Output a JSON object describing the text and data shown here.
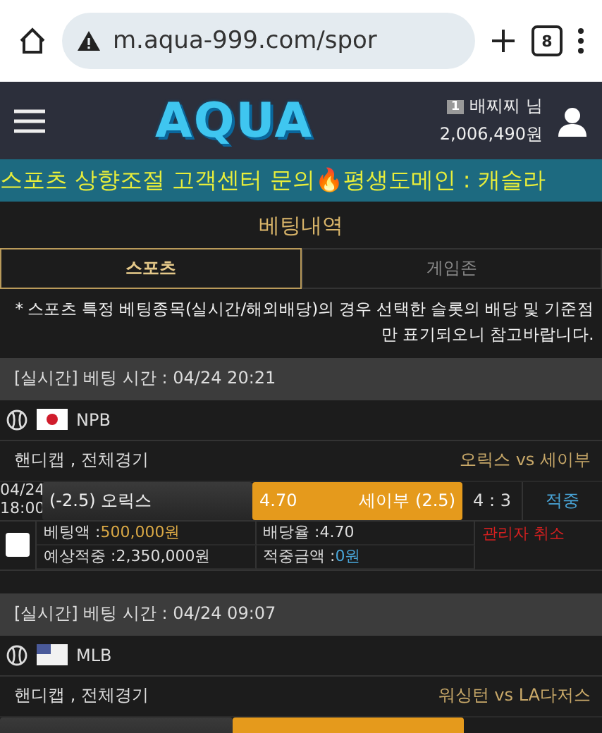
{
  "browser": {
    "url": "m.aqua-999.com/spor",
    "tab_count": "8"
  },
  "header": {
    "logo": "AQUA",
    "user_level": "1",
    "username": "배찌찌 님",
    "balance": "2,006,490원"
  },
  "banner": {
    "text": "스포츠 상향조절 고객센터 문의🔥평생도메인 : 캐슬라"
  },
  "page_title": "베팅내역",
  "tabs": [
    {
      "label": "스포츠",
      "selected": true
    },
    {
      "label": "게임존",
      "selected": false
    }
  ],
  "notice": "* 스포츠 특정 베팅종목(실시간/해외배당)의 경우 선택한 슬롯의 배당 및 기준점만 표기되오니 참고바랍니다.",
  "bets": [
    {
      "time_label": "[실시간] 베팅 시간 : 04/24 20:21",
      "kind": "jp",
      "league": "NPB",
      "market": "핸디캡 , 전체경기",
      "matchup": "오릭스 vs 세이부",
      "odds_row": {
        "date": "04/24",
        "time": "18:00",
        "home_pick": "(-2.5) 오릭스",
        "odds": "4.70",
        "away_pick": "세이부 (2.5)",
        "home_selected": false,
        "away_selected": true,
        "score": "4 : 3",
        "result": "적중"
      },
      "details": {
        "checked": false,
        "bet_amount_label": "베팅액 :",
        "bet_amount": "500,000원",
        "rate_label": "배당율 :",
        "rate": "4.70",
        "expected_label": "예상적중 :",
        "expected": "2,350,000원",
        "win_label": "적중금액 :",
        "win": "0원",
        "status": "관리자 취소"
      }
    },
    {
      "time_label": "[실시간] 베팅 시간 : 04/24 09:07",
      "kind": "us",
      "league": "MLB",
      "market": "핸디캡 , 전체경기",
      "matchup": "워싱턴 vs LA다저스",
      "odds_row": {
        "home_selected": false,
        "away_selected": true
      }
    }
  ]
}
